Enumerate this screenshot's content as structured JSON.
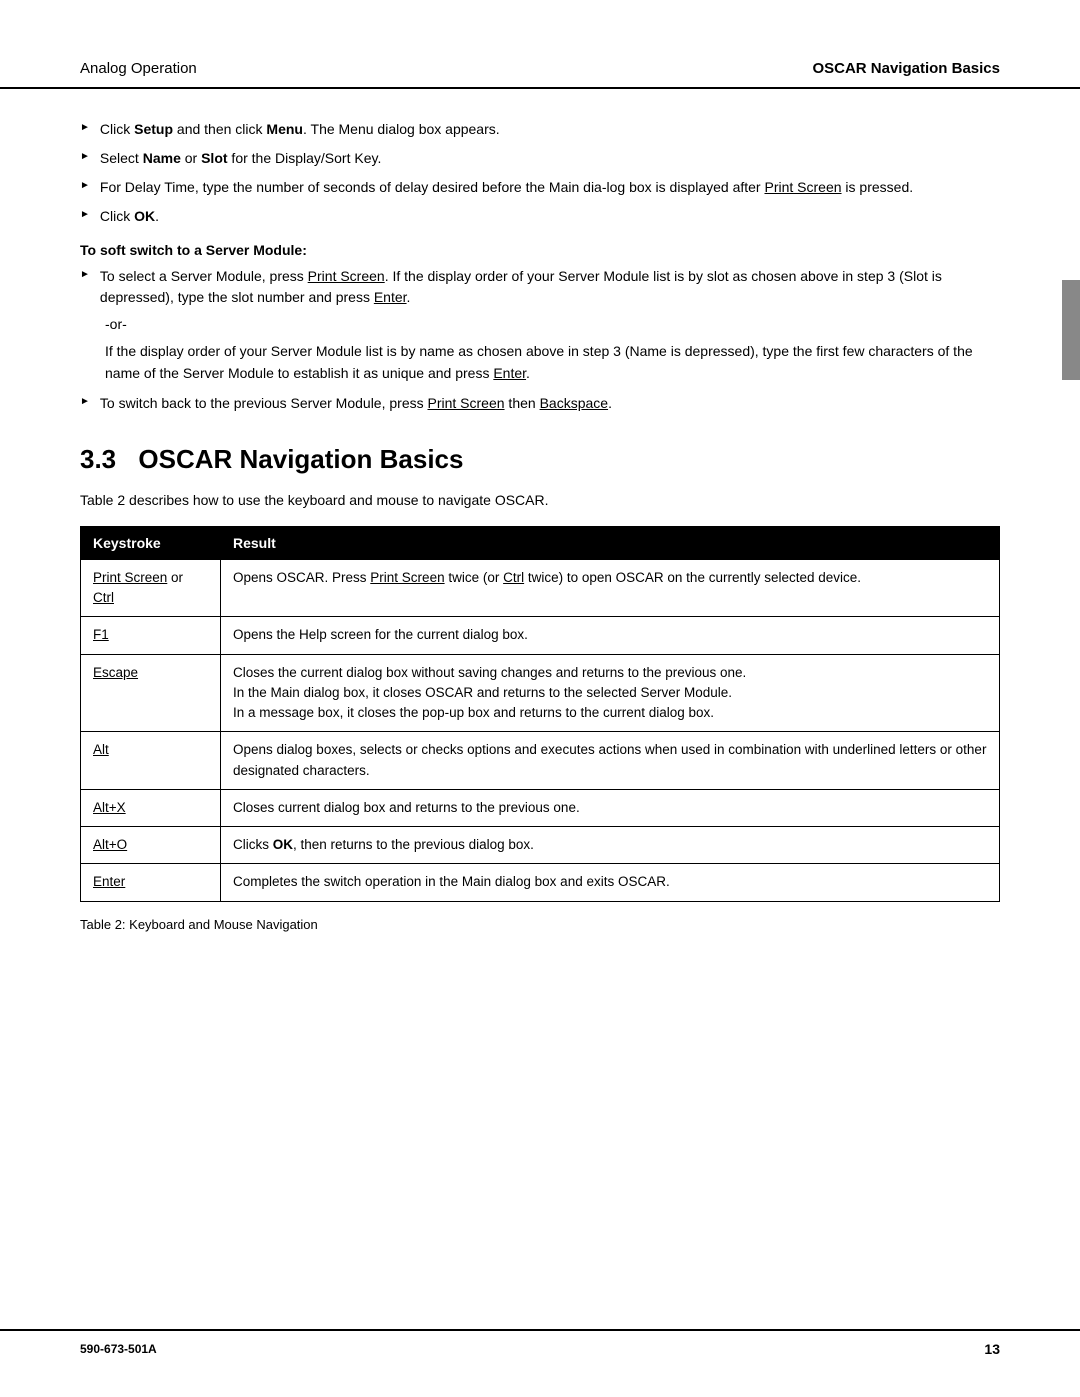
{
  "header": {
    "left": "Analog Operation",
    "right": "OSCAR Navigation Basics"
  },
  "bullets": [
    {
      "id": 1,
      "text": "Click <b>Setup</b> and then click <b>Menu</b>. The Menu dialog box appears."
    },
    {
      "id": 2,
      "text": "Select <b>Name</b> or <b>Slot</b> for the Display/Sort Key."
    },
    {
      "id": 3,
      "text": "For Delay Time, type the number of seconds of delay desired before the Main dia-log box is displayed after <u>Print Screen</u> is pressed."
    },
    {
      "id": 4,
      "text": "Click <b>OK</b>."
    }
  ],
  "subsection_title": "To soft switch to a Server Module:",
  "sub_bullets": [
    {
      "id": 1,
      "text": "To select a Server Module, press <u>Print Screen</u>. If the display order of your Server Module list is by slot as chosen above in step 3 (Slot is depressed), type the slot number and press <u>Enter</u>."
    }
  ],
  "or_text": "-or-",
  "italic_paragraph": "If the display order of your Server Module list is by name as chosen above in step 3 (Name is depressed), type the first few characters of the name of the Server Module to establish it as unique and press <u>Enter</u>.",
  "last_bullet": "To switch back to the previous Server Module, press <u>Print Screen</u> then <u>Backspace</u>.",
  "section": {
    "number": "3.3",
    "title": "OSCAR Navigation Basics"
  },
  "table_intro": "Table 2 describes how to use the keyboard and mouse to navigate OSCAR.",
  "table": {
    "headers": [
      "Keystroke",
      "Result"
    ],
    "rows": [
      {
        "key": "Print Screen or\nCtrl",
        "key_has_underline": true,
        "result": "Opens OSCAR. Press Print Screen twice (or Ctrl twice) to open OSCAR on the currently selected device."
      },
      {
        "key": "F1",
        "key_has_underline": true,
        "result": "Opens the Help screen for the current dialog box."
      },
      {
        "key": "Escape",
        "key_has_underline": true,
        "result": "Closes the current dialog box without saving changes and returns to the previous one.\nIn the Main dialog box, it closes OSCAR and returns to the selected Server Module.\nIn a message box, it closes the pop-up box and returns to the current dialog box."
      },
      {
        "key": "Alt",
        "key_has_underline": true,
        "result": "Opens dialog boxes, selects or checks options and executes actions when used in combination with underlined letters or other designated characters."
      },
      {
        "key": "Alt+X",
        "key_has_underline": true,
        "result": "Closes current dialog box and returns to the previous one."
      },
      {
        "key": "Alt+O",
        "key_has_underline": true,
        "result": "Clicks OK, then returns to the previous dialog box."
      },
      {
        "key": "Enter",
        "key_has_underline": true,
        "result": "Completes the switch operation in the Main dialog box and exits OSCAR."
      }
    ]
  },
  "table_caption": "Table 2: Keyboard and Mouse Navigation",
  "footer": {
    "left": "590-673-501A",
    "right": "13"
  }
}
